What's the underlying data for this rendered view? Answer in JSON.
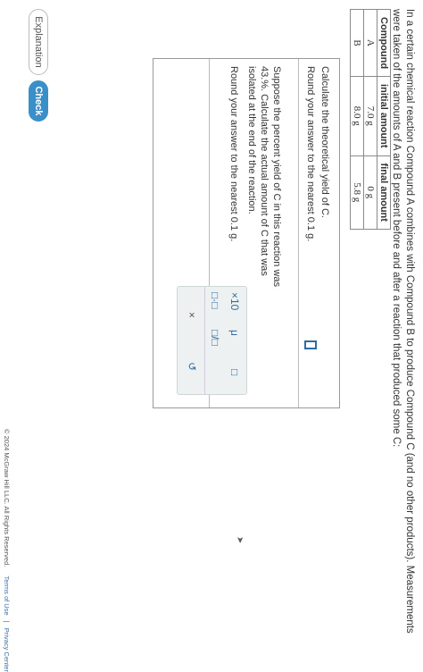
{
  "prompt": "In a certain chemical reaction Compound A combines with Compound B to produce Compound C (and no other products). Measurements were taken of the amounts of A and B present before and after a reaction that produced some C:",
  "table": {
    "headers": [
      "Compound",
      "initial amount",
      "final amount"
    ],
    "rows": [
      [
        "A",
        "7.0 g",
        "0 g"
      ],
      [
        "B",
        "8.0 g",
        "5.8 g"
      ]
    ]
  },
  "questions": [
    {
      "text": "Calculate the theoretical yield of C.",
      "round": "Round your answer to the nearest 0.1 g."
    },
    {
      "text": "Suppose the percent yield of C in this reaction was 43.%. Calculate the actual amount of C that was isolated at the end of the reaction.",
      "round": "Round your answer to the nearest 0.1 g."
    }
  ],
  "toolbar": {
    "sci_notation": "×10",
    "mu": "μ",
    "superscript": "□",
    "dot": "□·□",
    "fraction": "□/□",
    "clear": "×",
    "undo": "↺"
  },
  "buttons": {
    "explanation": "Explanation",
    "check": "Check"
  },
  "footer": {
    "copyright": "© 2024 McGraw Hill LLC. All Rights Reserved.",
    "terms": "Terms of Use",
    "separator": "|",
    "privacy": "Privacy Center"
  },
  "colors": {
    "accent": "#3a8fc8",
    "input_border": "#4a7fa5"
  }
}
